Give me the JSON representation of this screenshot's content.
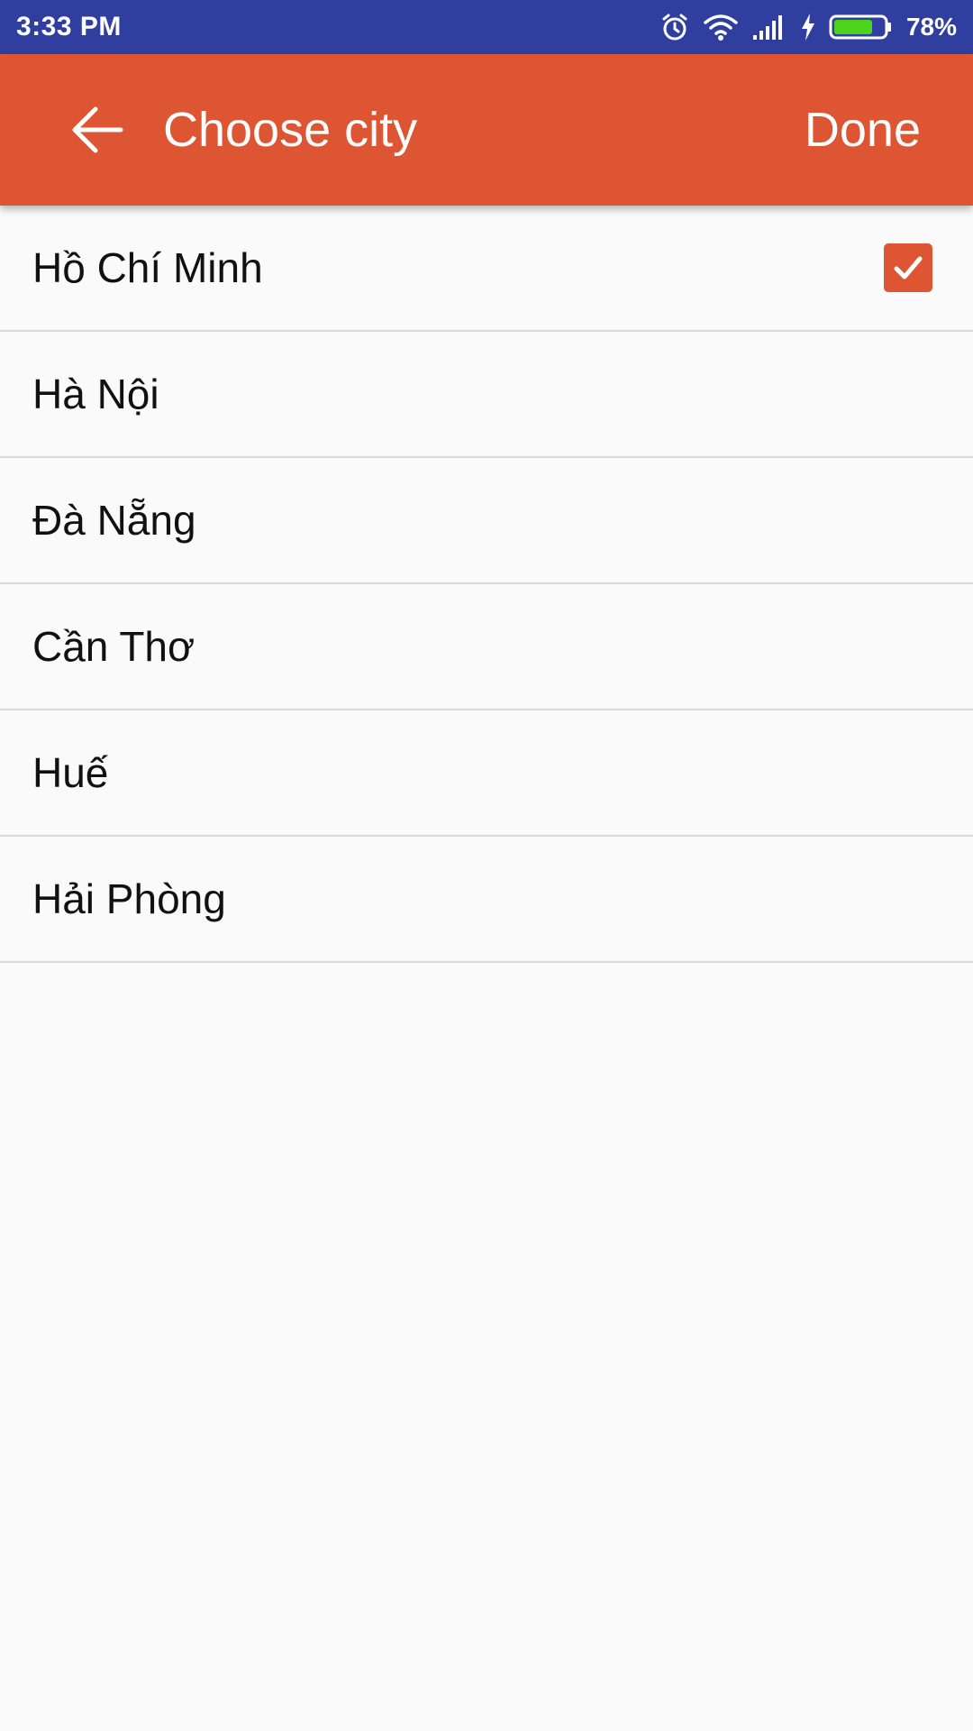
{
  "status_bar": {
    "time": "3:33 PM",
    "battery_percent": "78%",
    "battery_level": 0.78,
    "icons": [
      "alarm-icon",
      "wifi-icon",
      "signal-icon",
      "charging-icon",
      "battery-icon"
    ]
  },
  "toolbar": {
    "back_icon": "arrow-left-icon",
    "title": "Choose city",
    "done_label": "Done"
  },
  "cities": [
    {
      "name": "Hồ Chí Minh",
      "selected": true
    },
    {
      "name": "Hà Nội",
      "selected": false
    },
    {
      "name": "Đà Nẵng",
      "selected": false
    },
    {
      "name": "Cần Thơ",
      "selected": false
    },
    {
      "name": "Huế",
      "selected": false
    },
    {
      "name": "Hải Phòng",
      "selected": false
    }
  ],
  "colors": {
    "status_bar": "#303f9f",
    "toolbar": "#dd5533",
    "checkbox": "#dd5533",
    "background": "#fafafa",
    "divider": "#d9d9d9",
    "battery_fill": "#4cd41c"
  }
}
